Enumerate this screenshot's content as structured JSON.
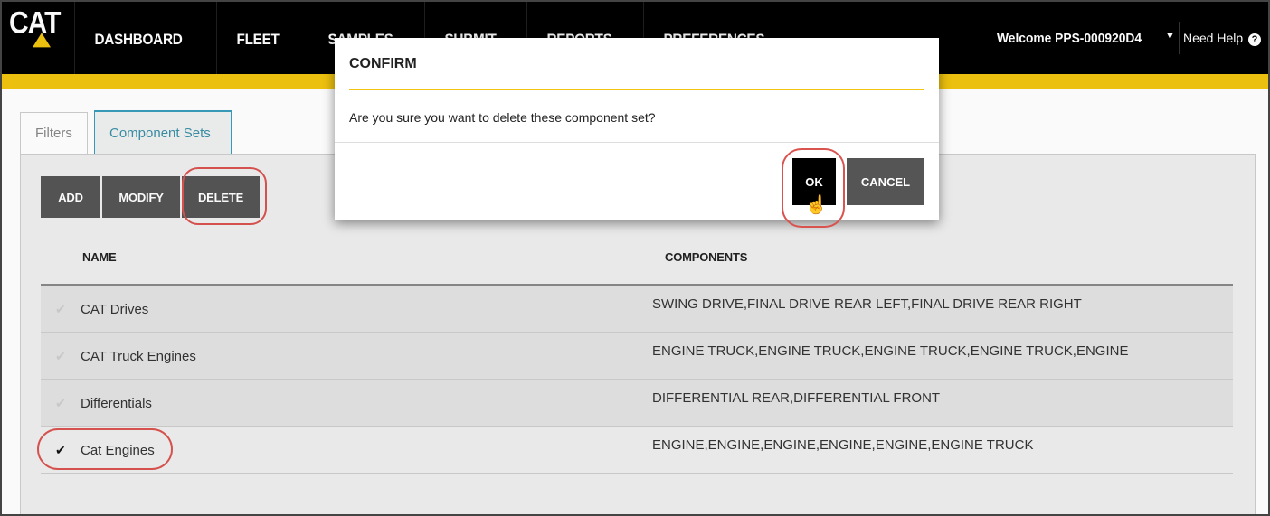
{
  "app": {
    "logo": "CAT"
  },
  "nav": {
    "items": [
      "DASHBOARD",
      "FLEET",
      "SAMPLES",
      "SUBMIT",
      "REPORTS",
      "PREFERENCES"
    ],
    "welcome": "Welcome PPS-000920D4",
    "help": "Need Help",
    "help_icon": "?"
  },
  "tabs": {
    "filters": "Filters",
    "component_sets": "Component Sets"
  },
  "toolbar": {
    "add": "ADD",
    "modify": "MODIFY",
    "delete": "DELETE"
  },
  "table": {
    "headers": {
      "name": "NAME",
      "components": "COMPONENTS"
    },
    "rows": [
      {
        "name": "CAT Drives",
        "components": "SWING DRIVE,FINAL DRIVE REAR LEFT,FINAL DRIVE REAR RIGHT",
        "checked": false
      },
      {
        "name": "CAT Truck Engines",
        "components": "ENGINE TRUCK,ENGINE TRUCK,ENGINE TRUCK,ENGINE TRUCK,ENGINE",
        "checked": false
      },
      {
        "name": "Differentials",
        "components": "DIFFERENTIAL REAR,DIFFERENTIAL FRONT",
        "checked": false
      },
      {
        "name": "Cat Engines",
        "components": "ENGINE,ENGINE,ENGINE,ENGINE,ENGINE,ENGINE TRUCK",
        "checked": true
      }
    ]
  },
  "modal": {
    "title": "CONFIRM",
    "message": "Are you sure you want to delete these component set?",
    "ok": "OK",
    "cancel": "CANCEL"
  },
  "glyphs": {
    "check": "✔",
    "caret": "▼",
    "pointer": "☝"
  },
  "colors": {
    "accent_yellow": "#f1c40f",
    "tab_blue": "#3a8ea6",
    "highlight_red": "#d9534f"
  }
}
